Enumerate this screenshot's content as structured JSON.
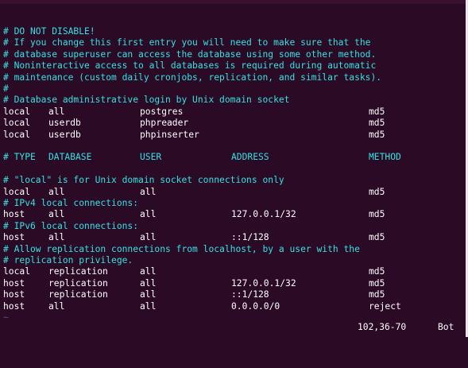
{
  "colors": {
    "background": "#2b0a26",
    "comment": "#34e2e2",
    "text": "#ffffff"
  },
  "lines": [
    {
      "kind": "comment",
      "text": "# DO NOT DISABLE!"
    },
    {
      "kind": "comment",
      "text": "# If you change this first entry you will need to make sure that the"
    },
    {
      "kind": "comment",
      "text": "# database superuser can access the database using some other method."
    },
    {
      "kind": "comment",
      "text": "# Noninteractive access to all databases is required during automatic"
    },
    {
      "kind": "comment",
      "text": "# maintenance (custom daily cronjobs, replication, and similar tasks)."
    },
    {
      "kind": "comment",
      "text": "#"
    },
    {
      "kind": "comment",
      "text": "# Database administrative login by Unix domain socket"
    },
    {
      "kind": "entry",
      "cols": [
        "local",
        "all",
        "postgres",
        "",
        "md5"
      ]
    },
    {
      "kind": "entry",
      "cols": [
        "local",
        "userdb",
        "phpreader",
        "",
        "md5"
      ]
    },
    {
      "kind": "entry",
      "cols": [
        "local",
        "userdb",
        "phpinserter",
        "",
        "md5"
      ]
    },
    {
      "kind": "blank",
      "text": ""
    },
    {
      "kind": "header",
      "cols": [
        "# TYPE",
        "DATABASE",
        "USER",
        "ADDRESS",
        "METHOD"
      ]
    },
    {
      "kind": "blank",
      "text": ""
    },
    {
      "kind": "comment",
      "text": "# \"local\" is for Unix domain socket connections only"
    },
    {
      "kind": "entry",
      "cols": [
        "local",
        "all",
        "all",
        "",
        "md5"
      ]
    },
    {
      "kind": "comment",
      "text": "# IPv4 local connections:"
    },
    {
      "kind": "entry",
      "cols": [
        "host",
        "all",
        "all",
        "127.0.0.1/32",
        "md5"
      ]
    },
    {
      "kind": "comment",
      "text": "# IPv6 local connections:"
    },
    {
      "kind": "entry",
      "cols": [
        "host",
        "all",
        "all",
        "::1/128",
        "md5"
      ]
    },
    {
      "kind": "comment",
      "text": "# Allow replication connections from localhost, by a user with the"
    },
    {
      "kind": "comment",
      "text": "# replication privilege."
    },
    {
      "kind": "entry",
      "cols": [
        "local",
        "replication",
        "all",
        "",
        "md5"
      ]
    },
    {
      "kind": "entry",
      "cols": [
        "host",
        "replication",
        "all",
        "127.0.0.1/32",
        "md5"
      ]
    },
    {
      "kind": "entry",
      "cols": [
        "host",
        "replication",
        "all",
        "::1/128",
        "md5"
      ]
    },
    {
      "kind": "entry",
      "cols": [
        "host",
        "all",
        "all",
        "0.0.0.0/0",
        "reject"
      ]
    },
    {
      "kind": "tilde",
      "text": "~"
    }
  ],
  "status": {
    "position": "102,36-70",
    "scroll": "Bot"
  }
}
